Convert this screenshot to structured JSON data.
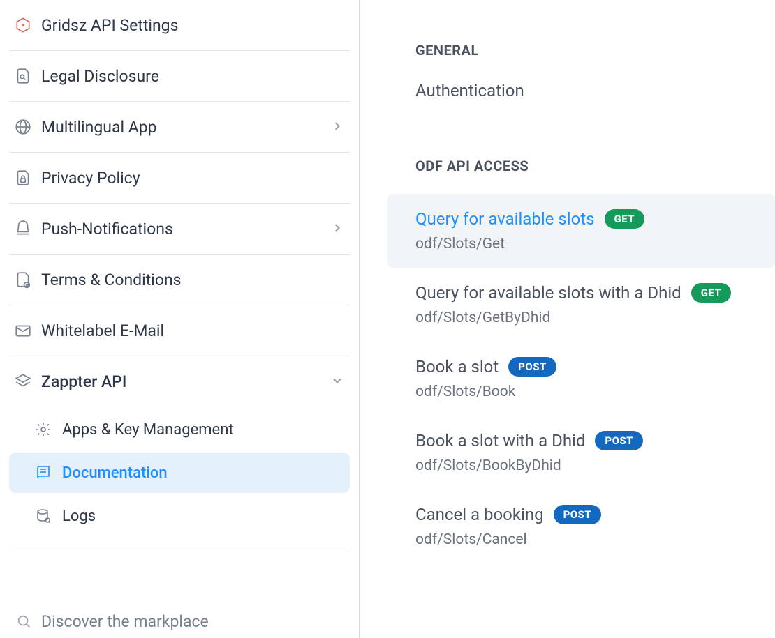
{
  "sidebar": {
    "items": [
      {
        "label": "Gridsz API Settings",
        "icon": "grid-icon",
        "expandable": false
      },
      {
        "label": "Legal Disclosure",
        "icon": "document-search-icon",
        "expandable": false
      },
      {
        "label": "Multilingual App",
        "icon": "globe-icon",
        "expandable": true
      },
      {
        "label": "Privacy Policy",
        "icon": "document-lock-icon",
        "expandable": false
      },
      {
        "label": "Push-Notifications",
        "icon": "bell-icon",
        "expandable": true
      },
      {
        "label": "Terms & Conditions",
        "icon": "document-plus-icon",
        "expandable": false
      },
      {
        "label": "Whitelabel E-Mail",
        "icon": "mail-icon",
        "expandable": false
      },
      {
        "label": "Zappter API",
        "icon": "layers-icon",
        "expandable": true,
        "expanded": true
      }
    ],
    "subitems": [
      {
        "label": "Apps & Key Management",
        "icon": "gear-icon",
        "active": false
      },
      {
        "label": "Documentation",
        "icon": "book-icon",
        "active": true
      },
      {
        "label": "Logs",
        "icon": "database-icon",
        "active": false
      }
    ],
    "discover_label": "Discover the markplace"
  },
  "content": {
    "sections": [
      {
        "header": "GENERAL",
        "links": [
          {
            "label": "Authentication"
          }
        ]
      },
      {
        "header": "ODF API ACCESS",
        "endpoints": [
          {
            "title": "Query for available slots",
            "method": "GET",
            "path": "odf/Slots/Get",
            "active": true
          },
          {
            "title": "Query for available slots with a Dhid",
            "method": "GET",
            "path": "odf/Slots/GetByDhid",
            "active": false,
            "clipped": true
          },
          {
            "title": "Book a slot",
            "method": "POST",
            "path": "odf/Slots/Book",
            "active": false
          },
          {
            "title": "Book a slot with a Dhid",
            "method": "POST",
            "path": "odf/Slots/BookByDhid",
            "active": false
          },
          {
            "title": "Cancel a booking",
            "method": "POST",
            "path": "odf/Slots/Cancel",
            "active": false
          }
        ]
      }
    ]
  },
  "colors": {
    "accent": "#1f8fff",
    "get": "#149a5a",
    "post": "#1368bf",
    "active_bg": "#e4f1fd",
    "endpoint_active_bg": "#f2f5f8"
  }
}
